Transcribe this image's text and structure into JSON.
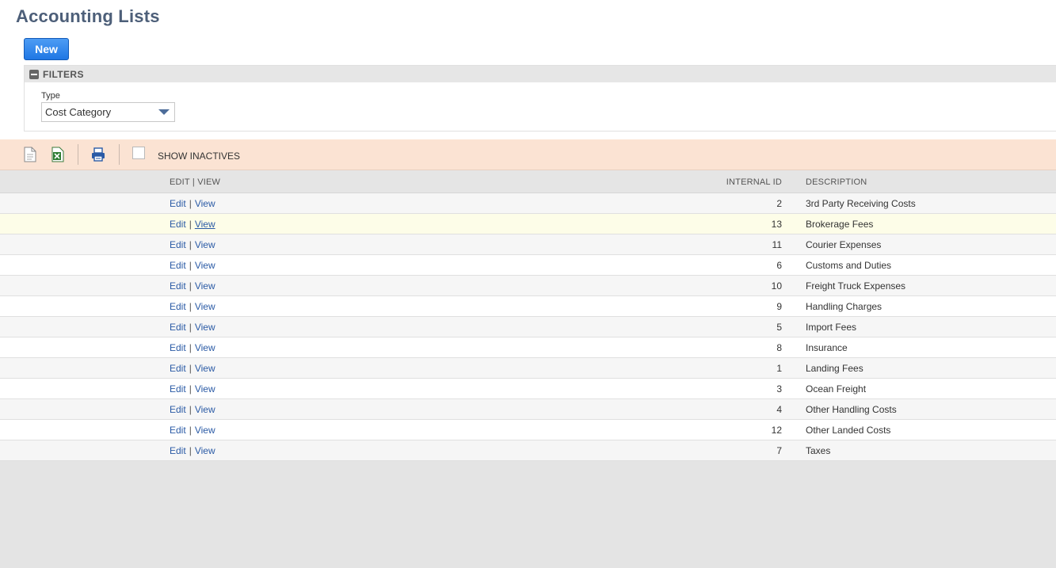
{
  "page": {
    "title": "Accounting Lists"
  },
  "buttons": {
    "new_label": "New"
  },
  "filters": {
    "header_label": "FILTERS",
    "type_label": "Type",
    "type_value": "Cost Category"
  },
  "toolbar": {
    "icons": [
      "export-document-icon",
      "export-excel-icon",
      "print-icon"
    ],
    "show_inactives_label": "SHOW INACTIVES",
    "show_inactives_checked": false
  },
  "table": {
    "columns": {
      "actions": "EDIT | VIEW",
      "internal_id": "INTERNAL ID",
      "description": "DESCRIPTION"
    },
    "edit_label": "Edit",
    "view_label": "View",
    "rows": [
      {
        "id": "2",
        "description": "3rd Party Receiving Costs"
      },
      {
        "id": "13",
        "description": "Brokerage Fees"
      },
      {
        "id": "11",
        "description": "Courier Expenses"
      },
      {
        "id": "6",
        "description": "Customs and Duties"
      },
      {
        "id": "10",
        "description": "Freight Truck Expenses"
      },
      {
        "id": "9",
        "description": "Handling Charges"
      },
      {
        "id": "5",
        "description": "Import Fees"
      },
      {
        "id": "8",
        "description": "Insurance"
      },
      {
        "id": "1",
        "description": "Landing Fees"
      },
      {
        "id": "3",
        "description": "Ocean Freight"
      },
      {
        "id": "4",
        "description": "Other Handling Costs"
      },
      {
        "id": "12",
        "description": "Other Landed Costs"
      },
      {
        "id": "7",
        "description": "Taxes"
      }
    ]
  }
}
